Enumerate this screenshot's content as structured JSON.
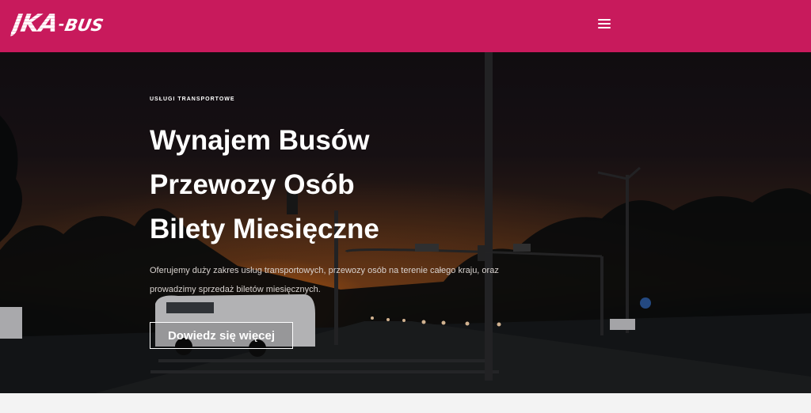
{
  "header": {
    "logo_main": "JKA",
    "logo_dash": "-",
    "logo_sub": "BUS",
    "menu_icon": "hamburger-menu-icon",
    "brand_color": "#c81a5c"
  },
  "hero": {
    "eyebrow": "USŁUGI TRANSPORTOWE",
    "headline": [
      "Wynajem Busów",
      "Przewozy Osób",
      "Bilety Miesięczne"
    ],
    "description": "Oferujemy duży zakres usług transportowych, przewozy osób na terenie całego kraju, oraz prowadzimy sprzedaż biletów miesięcznych.",
    "cta_label": "Dowiedz się więcej"
  }
}
